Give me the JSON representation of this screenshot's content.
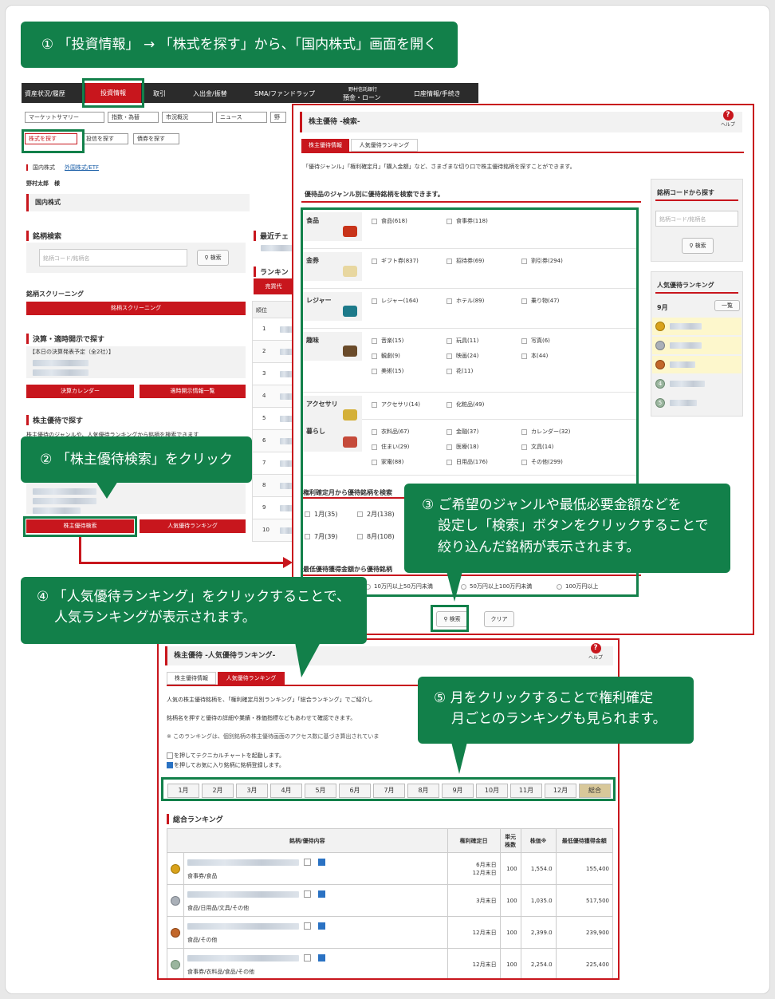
{
  "callouts": {
    "c1": "① 「投資情報」 → 「株式を探す」から、「国内株式」画面を開く",
    "c2": "② 「株主優待検索」をクリック",
    "c3": [
      "③ ご希望のジャンルや最低必要金額などを",
      "設定し「検索」ボタンをクリックすることで",
      "絞り込んだ銘柄が表示されます。"
    ],
    "c4": [
      "④ 「人気優待ランキング」をクリックすることで、",
      "人気ランキングが表示されます。"
    ],
    "c5": [
      "⑤ 月をクリックすることで権利確定",
      "月ごとのランキングも見られます。"
    ]
  },
  "topnav": {
    "items": [
      "資産状況/履歴",
      "投資情報",
      "取引",
      "入出金/振替",
      "SMA/ファンドラップ",
      "預金・ローン",
      "口座情報/手続き"
    ],
    "sub_small": "野村信託銀行"
  },
  "subnav": {
    "items": [
      "マーケットサマリー",
      "指数・為替",
      "市況概況",
      "ニュース",
      "野"
    ]
  },
  "subnav2": {
    "items": [
      "株式を探す",
      "投信を探す",
      "債券を探す"
    ]
  },
  "breadcrumb": {
    "items": [
      "国内株式",
      "外国株式/ETF"
    ]
  },
  "user": {
    "name": "野村太郎　様"
  },
  "domestic": {
    "page_title": "国内株式",
    "search_title": "銘柄検索",
    "search_placeholder": "銘柄コード/銘柄名",
    "search_button": "検索",
    "screening_title": "銘柄スクリーニング",
    "screening_button": "銘柄スクリーニング",
    "disclosure_title": "決算・適時開示で探す",
    "disclosure_today": "【本日の決算発表予定（全2社）】",
    "calendar_button": "決算カレンダー",
    "disclosure_button": "適時開示情報一覧",
    "yutai_title": "株主優待で探す",
    "yutai_desc": "株主優待のジャンルや、人気優待ランキングから銘柄を検索できます",
    "yutai_search_button": "株主優待検索",
    "yutai_ranking_button": "人気優待ランキング",
    "recent_title": "最近チェ",
    "ranking_title": "ランキン",
    "ranking_tab": "売買代",
    "rank_header": "順位",
    "ranks": [
      "1",
      "2",
      "3",
      "4",
      "5",
      "6",
      "7",
      "8",
      "9",
      "10"
    ]
  },
  "search_panel": {
    "title": "株主優待 -検索-",
    "help": "ヘルプ",
    "tabs": [
      "株主優待情報",
      "人気優待ランキング"
    ],
    "desc": "「優待ジャンル」「権利確定月」「購入金額」など、さまざまな切り口で株主優待銘柄を探すことができます。",
    "genre_title": "優待品のジャンル別に優待銘柄を検索できます。",
    "genres": [
      {
        "name": "食品",
        "options": [
          "食品(618)",
          "食事券(118)"
        ]
      },
      {
        "name": "金券",
        "options": [
          "ギフト券(837)",
          "招待券(69)",
          "割引券(294)"
        ]
      },
      {
        "name": "レジャー",
        "options": [
          "レジャー(164)",
          "ホテル(89)",
          "乗り物(47)"
        ]
      },
      {
        "name": "趣味",
        "options": [
          "音楽(15)",
          "玩具(11)",
          "写真(6)",
          "観劇(9)",
          "映画(24)",
          "本(44)",
          "美術(15)",
          "花(11)"
        ]
      },
      {
        "name": "アクセサリ",
        "options": [
          "アクセサリ(14)",
          "化粧品(49)"
        ]
      },
      {
        "name": "暮らし",
        "options": [
          "衣料品(67)",
          "金融(37)",
          "カレンダー(32)",
          "住まい(29)",
          "医療(18)",
          "文具(14)",
          "家電(88)",
          "日用品(176)",
          "その他(299)"
        ]
      }
    ],
    "month_title": "権利確定月から優待銘柄を検索",
    "months": [
      "1月(35)",
      "2月(138)",
      "7月(39)",
      "8月(108)"
    ],
    "amount_title": "最低優待獲得金額から優待銘柄",
    "amounts": [
      "10万円以上50万円未満",
      "50万円以上100万円未満",
      "100万円以上"
    ],
    "search_button": "検索",
    "clear_button": "クリア",
    "code_title": "銘柄コードから探す",
    "code_placeholder": "銘柄コード/銘柄名",
    "code_button": "検索",
    "rank_title": "人気優待ランキング",
    "rank_month": "9月",
    "rank_list_button": "一覧",
    "rank_nums": [
      "4",
      "5"
    ]
  },
  "ranking_panel": {
    "title": "株主優待 -人気優待ランキング-",
    "help": "ヘルプ",
    "tabs": [
      "株主優待情報",
      "人気優待ランキング"
    ],
    "desc1": "人気の株主優待銘柄を、「権利確定月別ランキング」「総合ランキング」でご紹介し",
    "desc2": "銘柄名を押すと優待の詳細や業績・株価指標などもあわせて確認できます。",
    "desc3": "※ このランキングは、個別銘柄の株主優待画面のアクセス数に基づき算出されていま",
    "desc4": "を押してテクニカルチャートを起動します。",
    "desc5": "を押してお気に入り銘柄に銘柄登録します。",
    "months": [
      "1月",
      "2月",
      "3月",
      "4月",
      "5月",
      "6月",
      "7月",
      "8月",
      "9月",
      "10月",
      "11月",
      "12月",
      "総合"
    ],
    "total_title": "総合ランキング",
    "headers": [
      "銘柄/優待内容",
      "権利確定日",
      "単元株数",
      "株価※",
      "最低優待獲得金額"
    ],
    "rows": [
      {
        "rank": "1",
        "genre": "食事券/食品",
        "dates": [
          "6月末日",
          "12月末日"
        ],
        "unit": "100",
        "price": "1,554.0",
        "min": "155,400"
      },
      {
        "rank": "2",
        "genre": "食品/日用品/文具/その他",
        "dates": [
          "3月末日"
        ],
        "unit": "100",
        "price": "1,035.0",
        "min": "517,500"
      },
      {
        "rank": "3",
        "genre": "食品/その他",
        "dates": [
          "12月末日"
        ],
        "unit": "100",
        "price": "2,399.0",
        "min": "239,900"
      },
      {
        "rank": "4",
        "genre": "食事券/衣料品/食品/その他",
        "dates": [
          "12月末日"
        ],
        "unit": "100",
        "price": "2,254.0",
        "min": "225,400"
      }
    ]
  }
}
